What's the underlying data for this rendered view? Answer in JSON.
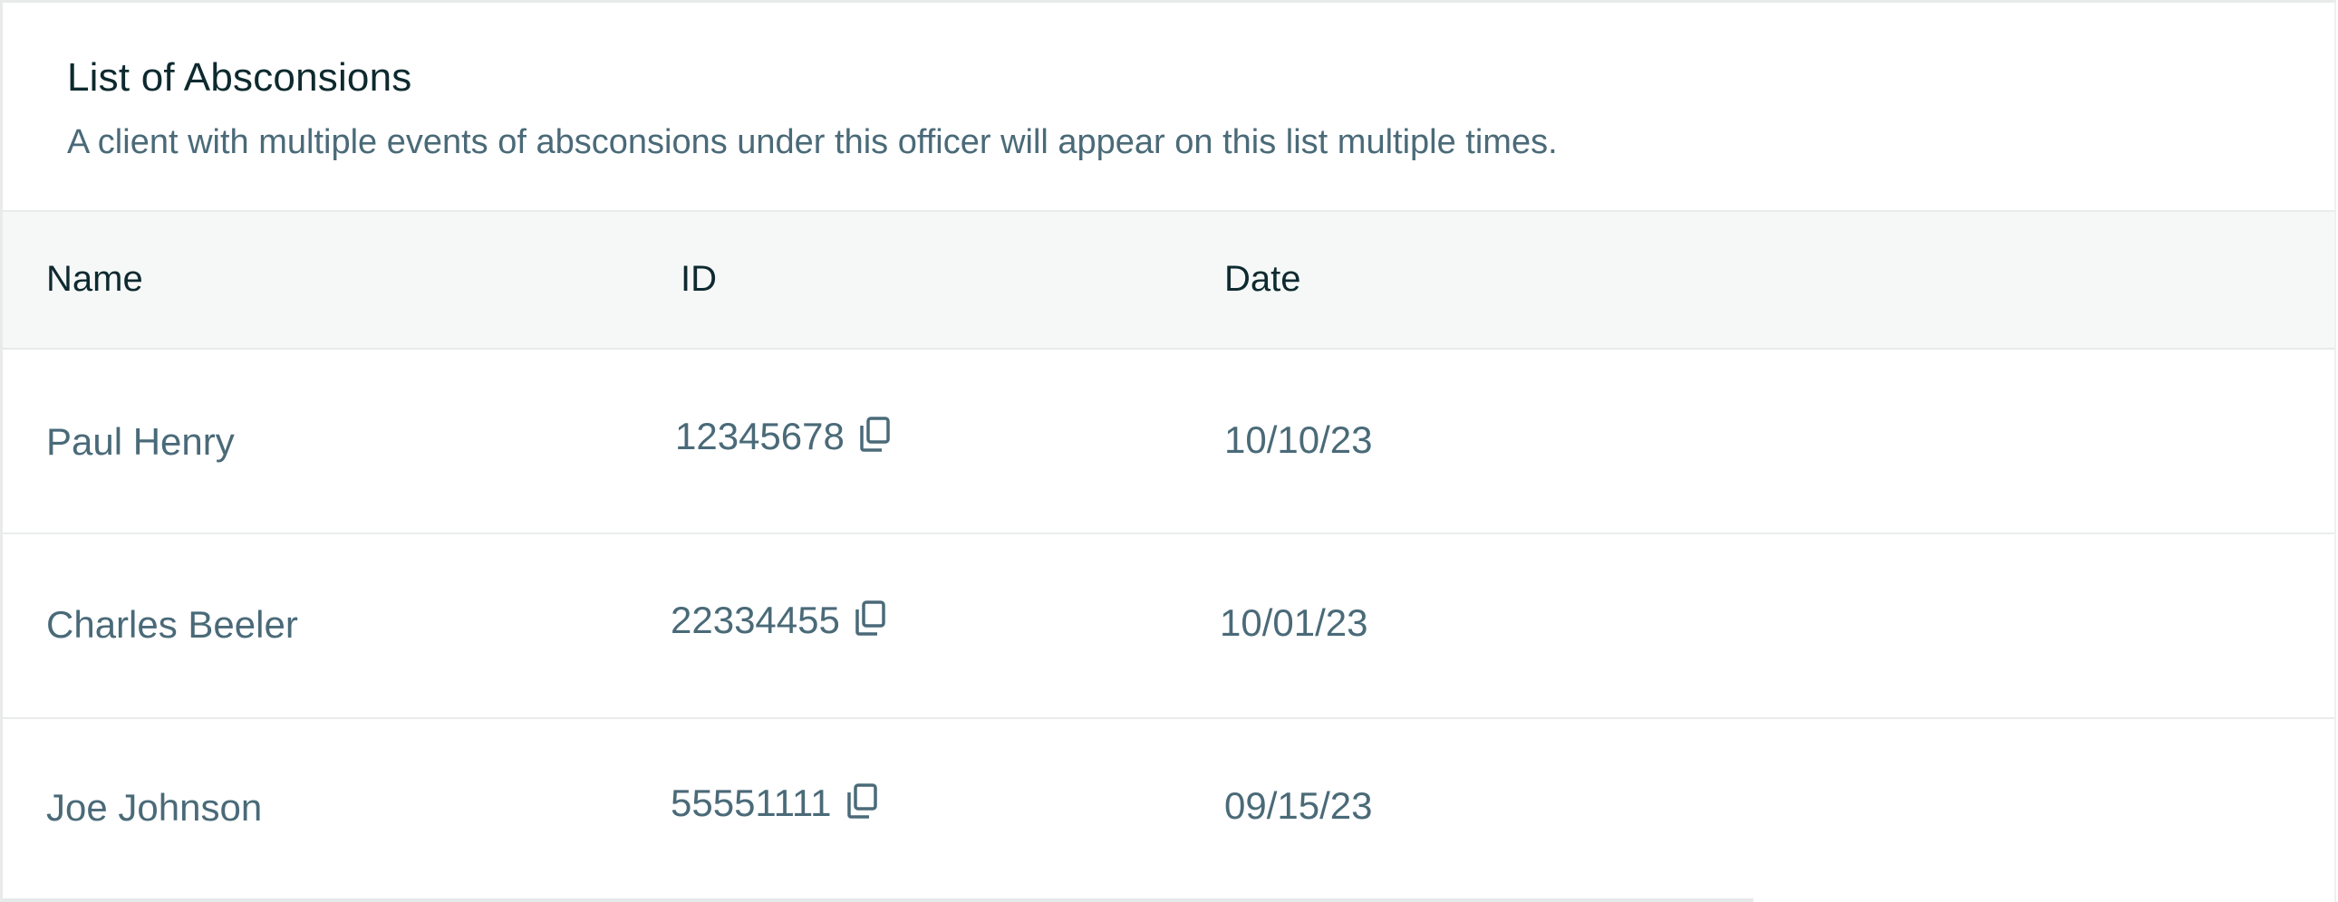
{
  "header": {
    "title": "List of Absconsions",
    "subtitle": "A client with multiple events of absconsions under this officer will appear on this list multiple times."
  },
  "table": {
    "columns": {
      "name": "Name",
      "id": "ID",
      "date": "Date"
    },
    "rows": [
      {
        "name": "Paul Henry",
        "id": "12345678",
        "date": "10/10/23"
      },
      {
        "name": "Charles Beeler",
        "id": "22334455",
        "date": "10/01/23"
      },
      {
        "name": "Joe Johnson",
        "id": "55551111",
        "date": "09/15/23"
      }
    ]
  },
  "icons": {
    "copy": "copy-icon"
  },
  "colors": {
    "title": "#0d2a2e",
    "body_text": "#4a6a78",
    "header_bg": "#f6f8f7",
    "border": "#e9eceb"
  }
}
